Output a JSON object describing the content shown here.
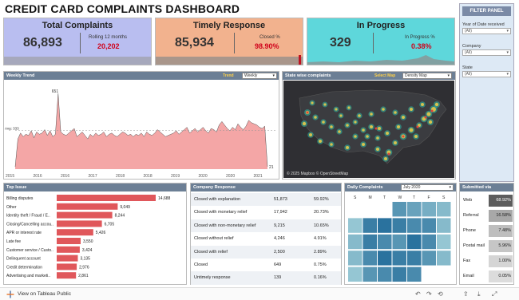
{
  "dashboard": {
    "title": "CREDIT CARD COMPLAINTS DASHBOARD"
  },
  "kpis": {
    "total": {
      "title": "Total Complaints",
      "value": "86,893",
      "sub_label": "Rolling 12 months",
      "sub_value": "20,202",
      "color": "#b9bef0"
    },
    "timely": {
      "title": "Timely Response",
      "value": "85,934",
      "sub_label": "Closed %",
      "sub_value": "98.90%",
      "color": "#f2b28e"
    },
    "progress": {
      "title": "In Progress",
      "value": "329",
      "sub_label": "In Progress %",
      "sub_value": "0.38%",
      "color": "#5ed7db"
    }
  },
  "filter_panel": {
    "title": "FILTER PANEL",
    "filters": [
      {
        "label": "Year of Date received",
        "value": "(All)"
      },
      {
        "label": "Company",
        "value": "(All)"
      },
      {
        "label": "State",
        "value": "(All)"
      }
    ]
  },
  "weekly_trend": {
    "title": "Weekly Trend",
    "control_label": "Trend",
    "control_value": "Weekly",
    "chart_data": {
      "type": "area",
      "x_ticks": [
        "2015",
        "2016",
        "2016",
        "2017",
        "2018",
        "2018",
        "2019",
        "2020",
        "2020",
        "2021"
      ],
      "peak_label": "651",
      "last_label": "21",
      "avg_label": "Avg: 333",
      "values": [
        20,
        260,
        310,
        280,
        300,
        290,
        330,
        270,
        320,
        300,
        310,
        340,
        290,
        330,
        280,
        300,
        651,
        320,
        300,
        290,
        310,
        330,
        350,
        280,
        300,
        320,
        290,
        260,
        300,
        280,
        310,
        290,
        300,
        320,
        280,
        300,
        310,
        290,
        280,
        300,
        320,
        310,
        290,
        300,
        280,
        300,
        290,
        310,
        280,
        320,
        300,
        290,
        310,
        340,
        320,
        300,
        280,
        290,
        300,
        310,
        330,
        300,
        320,
        340,
        360,
        310,
        330,
        350,
        320,
        340,
        360,
        330,
        310,
        350,
        340,
        320,
        380,
        410,
        380,
        350,
        330,
        360,
        340,
        390,
        360,
        340,
        370,
        420,
        400,
        390,
        380,
        360,
        350,
        370,
        21
      ],
      "color": "#f4a6a6"
    }
  },
  "state_map": {
    "title": "State wise complaints",
    "control_label": "Select Map",
    "control_value": "Density Map",
    "credit": "© 2025 Mapbox  © OpenStreetMap"
  },
  "top_issue": {
    "title": "Top Issue",
    "chart_data": {
      "type": "bar",
      "categories": [
        "Billing disputes",
        "Other",
        "Identity theft / Fraud / E..",
        "Closing/Cancelling accou..",
        "APR or interest rate",
        "Late fee",
        "Customer service / Custo..",
        "Delinquent account",
        "Credit determination",
        "Advertising and marketi.."
      ],
      "values": [
        14688,
        9049,
        8244,
        6705,
        5426,
        3550,
        3424,
        3135,
        2976,
        2861
      ],
      "labels": [
        "14,688",
        "9,049",
        "8,244",
        "6,705",
        "5,426",
        "3,550",
        "3,424",
        "3,135",
        "2,976",
        "2,861"
      ],
      "color": "#e0575b"
    }
  },
  "company_response": {
    "title": "Company Response",
    "rows": [
      {
        "label": "Closed with explanation",
        "count": "51,873",
        "pct": "59.92%"
      },
      {
        "label": "Closed with monetary relief",
        "count": "17,942",
        "pct": "20.73%"
      },
      {
        "label": "Closed with non-monetary relief",
        "count": "9,215",
        "pct": "10.65%"
      },
      {
        "label": "Closed without relief",
        "count": "4,246",
        "pct": "4.91%"
      },
      {
        "label": "Closed with relief",
        "count": "2,500",
        "pct": "2.89%"
      },
      {
        "label": "Closed",
        "count": "649",
        "pct": "0.75%"
      },
      {
        "label": "Untimely response",
        "count": "139",
        "pct": "0.16%"
      }
    ]
  },
  "daily_complaints": {
    "title": "Daily Complaints",
    "month": "July 2020",
    "weekdays": [
      "S",
      "M",
      "T",
      "W",
      "T",
      "F",
      "S"
    ],
    "cells": [
      [
        "",
        "",
        "",
        "0.6",
        "0.5",
        "0.4",
        "0.3"
      ],
      [
        "0.2",
        "0.8",
        "0.9",
        "0.8",
        "0.7",
        "0.7",
        "0.3"
      ],
      [
        "0.3",
        "0.8",
        "0.7",
        "0.6",
        "0.9",
        "0.7",
        "0.2"
      ],
      [
        "0.3",
        "0.7",
        "0.9",
        "0.8",
        "0.8",
        "0.6",
        "0.3"
      ],
      [
        "0.2",
        "0.6",
        "0.7",
        "0.8",
        "0.7",
        "",
        ""
      ]
    ]
  },
  "submitted_via": {
    "title": "Submitted via",
    "rows": [
      {
        "label": "Web",
        "pct": "68.92%"
      },
      {
        "label": "Referral",
        "pct": "16.58%"
      },
      {
        "label": "Phone",
        "pct": "7.48%"
      },
      {
        "label": "Postal mail",
        "pct": "5.96%"
      },
      {
        "label": "Fax",
        "pct": "1.00%"
      },
      {
        "label": "Email",
        "pct": "0.05%"
      }
    ],
    "shades": [
      0.95,
      0.45,
      0.3,
      0.25,
      0.15,
      0.1
    ]
  },
  "footer": {
    "text": "View on Tableau Public"
  }
}
